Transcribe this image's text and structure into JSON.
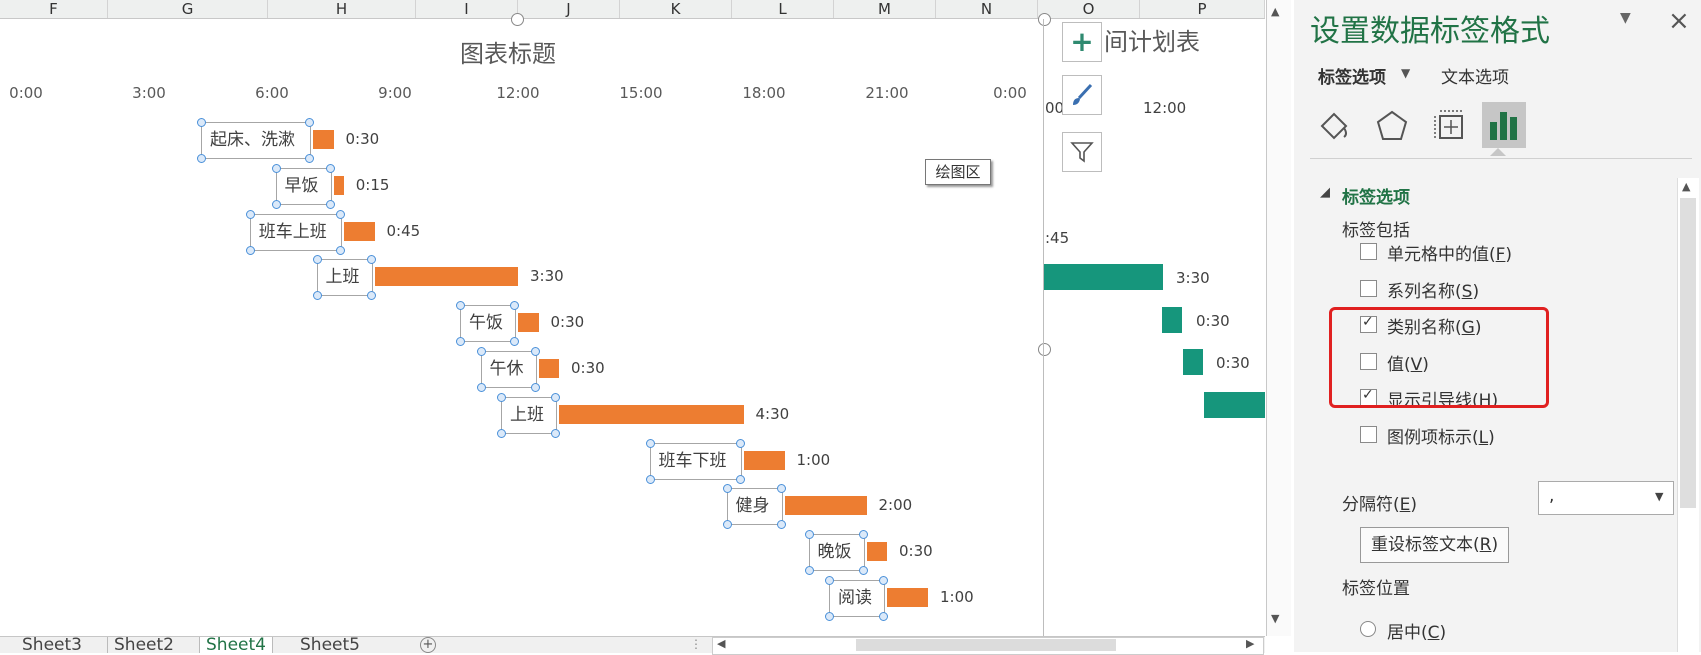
{
  "columns": [
    "F",
    "G",
    "H",
    "I",
    "J",
    "K",
    "L",
    "M",
    "N",
    "O",
    "P"
  ],
  "chart": {
    "title": "图表标题",
    "axis_ticks": [
      "0:00",
      "3:00",
      "6:00",
      "9:00",
      "12:00",
      "15:00",
      "18:00",
      "21:00",
      "0:00"
    ],
    "plot_area_tooltip": "绘图区",
    "tasks": [
      {
        "category": "起床、洗漱",
        "duration": "0:30"
      },
      {
        "category": "早饭",
        "duration": "0:15"
      },
      {
        "category": "班车上班",
        "duration": "0:45"
      },
      {
        "category": "上班",
        "duration": "3:30"
      },
      {
        "category": "午饭",
        "duration": "0:30"
      },
      {
        "category": "午休",
        "duration": "0:30"
      },
      {
        "category": "上班",
        "duration": "4:30"
      },
      {
        "category": "班车下班",
        "duration": "1:00"
      },
      {
        "category": "健身",
        "duration": "2:00"
      },
      {
        "category": "晚饭",
        "duration": "0:30"
      },
      {
        "category": "阅读",
        "duration": "1:00"
      }
    ],
    "bar_color": "#ed7d31"
  },
  "second_chart": {
    "title_fragment": "间计划表",
    "axis_ticks": [
      "00",
      "12:00"
    ],
    "value_labels": [
      ":45",
      "3:30",
      "0:30",
      "0:30"
    ],
    "bar_color": "#16967c"
  },
  "chart_tools": [
    "plus-icon",
    "brush-icon",
    "filter-icon"
  ],
  "sheet_tabs": [
    "Sheet3",
    "Sheet2",
    "Sheet4",
    "Sheet5"
  ],
  "active_tab": "Sheet4",
  "pane": {
    "title": "设置数据标签格式",
    "tab_label_options": "标签选项",
    "tab_text_options": "文本选项",
    "section_title": "标签选项",
    "label_contains": "标签包括",
    "options": [
      {
        "label": "单元格中的值(",
        "key": "F",
        "checked": false
      },
      {
        "label": "系列名称(",
        "key": "S",
        "checked": false
      },
      {
        "label": "类别名称(",
        "key": "G",
        "checked": true
      },
      {
        "label": "值(",
        "key": "V",
        "checked": false
      },
      {
        "label": "显示引导线(",
        "key": "H",
        "checked": true
      },
      {
        "label": "图例项标示(",
        "key": "L",
        "checked": false
      }
    ],
    "separator_label": "分隔符(",
    "separator_key": "E",
    "separator_value": ",",
    "reset_button_text": "重设标签文本(",
    "reset_button_key": "R",
    "label_position": "标签位置",
    "position_center": "居中(",
    "position_center_key": "C",
    "highlight_color": "#e02020"
  }
}
